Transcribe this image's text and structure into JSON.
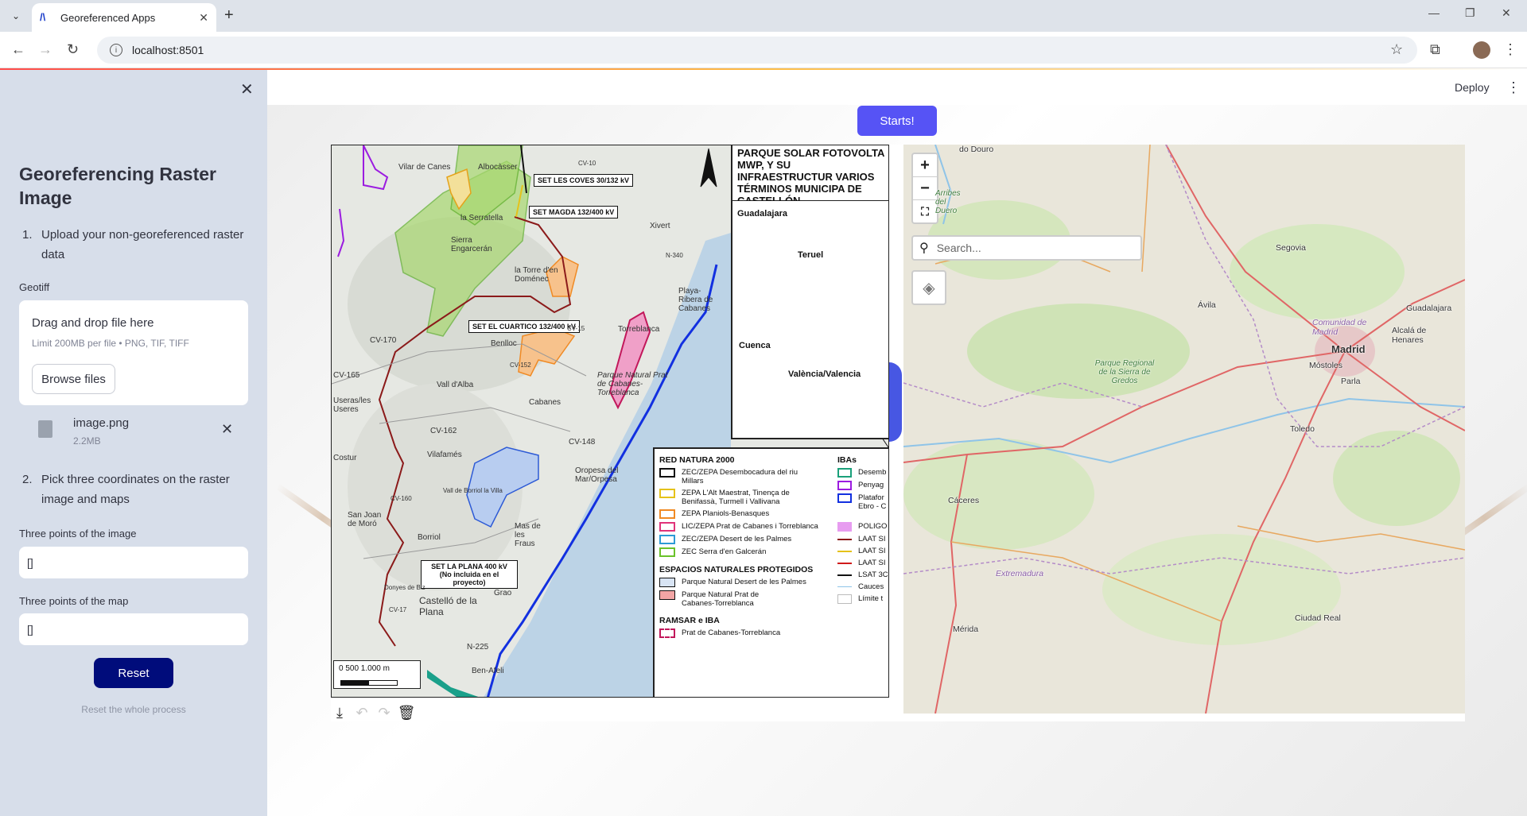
{
  "browser": {
    "tab_title": "Georeferenced Apps",
    "url": "localhost:8501"
  },
  "sidebar": {
    "title": "Georeferencing Raster Image",
    "step1_num": "1.",
    "step1": "Upload your non-georeferenced raster data",
    "geotiff_label": "Geotiff",
    "dropzone_title": "Drag and drop file here",
    "dropzone_limit": "Limit 200MB per file • PNG, TIF, TIFF",
    "browse_label": "Browse files",
    "file_name": "image.png",
    "file_size": "2.2MB",
    "step2_num": "2.",
    "step2": "Pick three coordinates on the raster image and maps",
    "image_points_label": "Three points of the image",
    "image_points_value": "[]",
    "map_points_label": "Three points of the map",
    "map_points_value": "[]",
    "reset_label": "Reset",
    "reset_help": "Reset the whole process"
  },
  "header": {
    "deploy_label": "Deploy"
  },
  "main": {
    "starts_label": "Starts!"
  },
  "raster": {
    "title": "PARQUE SOLAR FOTOVOLTA MWP, Y SU INFRAESTRUCTUR VARIOS TÉRMINOS MUNICIPA DE CASTELLÓN",
    "inset_labels": [
      "Guadalajara",
      "Teruel",
      "Cuenca",
      "València/Valencia"
    ],
    "callouts": [
      "SET LES COVES 30/132 kV",
      "SET MAGDA 132/400 kV",
      "SET EL CUARTICO 132/400 kV",
      "SET LA PLANA 400 kV (No incluida en el proyecto)"
    ],
    "place_labels": [
      "Vilar de Canes",
      "Albocàsser",
      "Xivert",
      "la Serratella",
      "Sierra Engarcerán",
      "la Torre d'en Doménec",
      "Torreblanca",
      "Playa-Ribera de Cabanes",
      "Benlloc",
      "CV-170",
      "CV-165",
      "Vall d'Alba",
      "Cabanes",
      "Parque Natural Prat de Cabanes-Torreblanca",
      "Useras/les Useres",
      "CV-162",
      "Costur",
      "Vilafamés",
      "Oropesa del Mar/Orpesa",
      "CV-148",
      "Vall de Borriol la Villa",
      "San Joan de Moró",
      "Borriol",
      "Mas de les Fraus",
      "Grao",
      "Castelló de la Plana",
      "N-225",
      "Ben-Afeli",
      "CV-10",
      "CV-15",
      "N-340",
      "CV-152",
      "CV-160",
      "CV-17",
      "Donyes de Biz"
    ],
    "legend": {
      "red_natura_title": "RED NATURA 2000",
      "red_natura_items": [
        "ZEC/ZEPA Desembocadura del riu Millars",
        "ZEPA L'Alt Maestrat, Tinença de Benifassà, Turmell i Vallivana",
        "ZEPA Planiols-Benasques",
        "LIC/ZEPA Prat de Cabanes i Torreblanca",
        "ZEC/ZEPA Desert de les Palmes",
        "ZEC Serra d'en Galcerán"
      ],
      "espacios_title": "ESPACIOS NATURALES PROTEGIDOS",
      "espacios_items": [
        "Parque Natural Desert de les Palmes",
        "Parque Natural Prat de Cabanes-Torreblanca"
      ],
      "ramsar_title": "RAMSAR e IBA",
      "ramsar_items": [
        "Prat de Cabanes-Torreblanca"
      ],
      "ibas_title": "IBAs",
      "ibas_items": [
        "Desemb",
        "Penyag",
        "Platafor Ebro - C",
        "POLIGO",
        "LAAT SI",
        "LAAT SI",
        "LAAT SI",
        "LSAT 3C",
        "Cauces",
        "Límite t"
      ]
    },
    "scale_text": "0     500    1.000 m",
    "swatch_colors": [
      "#111111",
      "#e5c21a",
      "#f08a24",
      "#e0337a",
      "#2d9ad6",
      "#6ac22a",
      "#d8e4f4",
      "#f2a5a5",
      "#c2185b"
    ]
  },
  "webmap": {
    "zoom_in": "+",
    "zoom_out": "−",
    "search_placeholder": "Search...",
    "cities": [
      "do Douro",
      "Segovia",
      "Ávila",
      "Guadalajara",
      "Comunidad de Madrid",
      "Alcalá de Henares",
      "Madrid",
      "Móstoles",
      "Parla",
      "Parque Regional de la Sierra de Gredos",
      "Toledo",
      "Cáceres",
      "Extremadura",
      "Ciudad Real",
      "Mérida",
      "Arribes del Duero"
    ]
  },
  "colors": {
    "sidebar_bg": "#d7deea",
    "reset_btn": "#000c7b",
    "starts_btn": "#5653f5",
    "accent_line": "#ff4b4b"
  }
}
